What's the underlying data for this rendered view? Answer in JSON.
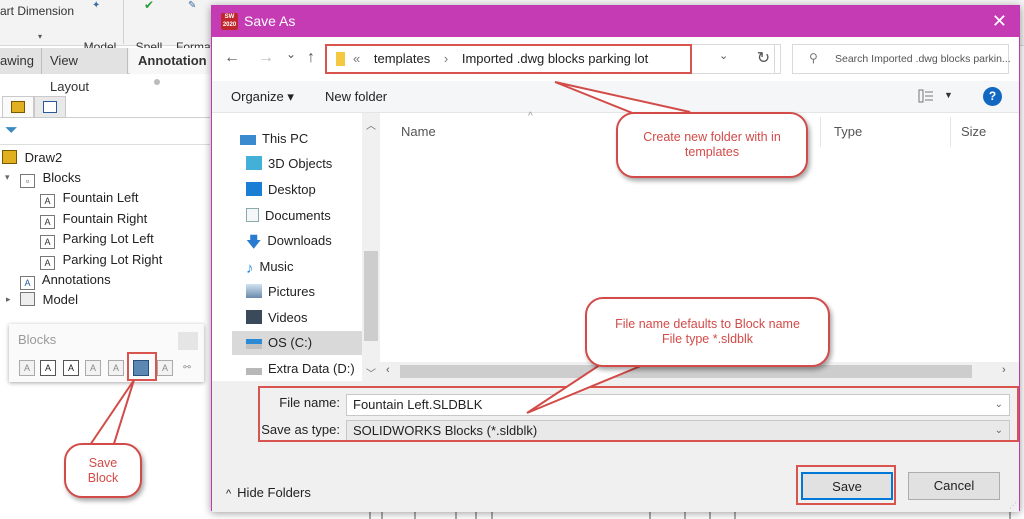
{
  "ribbon": {
    "items": [
      {
        "label": "art Dimension",
        "name": "smart-dimension"
      },
      {
        "label": "Model\nItems",
        "name": "model-items"
      },
      {
        "label": "Spell\nChecker",
        "name": "spell-checker"
      },
      {
        "label": "Forma\nPainte",
        "name": "format-painter"
      }
    ],
    "tabs": [
      "awing",
      "View Layout",
      "Annotation"
    ],
    "active_tab": "Annotation"
  },
  "feature_tree": {
    "root": "Draw2",
    "items": [
      {
        "label": "Blocks",
        "level": 1,
        "expanded": true,
        "icon": "folder-icon"
      },
      {
        "label": "Fountain Left",
        "level": 2,
        "icon": "block-icon"
      },
      {
        "label": "Fountain Right",
        "level": 2,
        "icon": "block-icon"
      },
      {
        "label": "Parking Lot Left",
        "level": 2,
        "icon": "block-icon"
      },
      {
        "label": "Parking Lot Right",
        "level": 2,
        "icon": "block-icon"
      },
      {
        "label": "Annotations",
        "level": 1,
        "icon": "annotations-folder-icon"
      },
      {
        "label": "Model",
        "level": 1,
        "expanded": false,
        "icon": "model-folder-icon"
      }
    ]
  },
  "blocks_toolbar": {
    "title": "Blocks",
    "highlighted_tool": "save-block"
  },
  "callouts": {
    "save_block": "Save\nBlock",
    "new_folder": "Create new folder with in\ntemplates",
    "file_name": "File name defaults to Block name\nFile type *.sldblk"
  },
  "dialog": {
    "title": "Save As",
    "app_icon_text": "SW\n2020",
    "close": "✕",
    "nav": {
      "back": "←",
      "forward": "→",
      "recent": "⌄",
      "up": "↑"
    },
    "address": {
      "prefix": "«",
      "crumbs": [
        "templates",
        "Imported .dwg blocks parking lot"
      ],
      "separator": "›"
    },
    "refresh": "↻",
    "search_placeholder": "Search Imported .dwg blocks parkin...",
    "commands": {
      "organize": "Organize ▾",
      "new_folder": "New folder"
    },
    "help": "?",
    "nav_pane": [
      {
        "label": "This PC",
        "icon": "this-pc-icon",
        "indent": 0
      },
      {
        "label": "3D Objects",
        "icon": "3d-objects-icon",
        "indent": 1
      },
      {
        "label": "Desktop",
        "icon": "desktop-icon",
        "indent": 1
      },
      {
        "label": "Documents",
        "icon": "documents-icon",
        "indent": 1
      },
      {
        "label": "Downloads",
        "icon": "downloads-icon",
        "indent": 1
      },
      {
        "label": "Music",
        "icon": "music-icon",
        "indent": 1
      },
      {
        "label": "Pictures",
        "icon": "pictures-icon",
        "indent": 1
      },
      {
        "label": "Videos",
        "icon": "videos-icon",
        "indent": 1
      },
      {
        "label": "OS (C:)",
        "icon": "drive-c-icon",
        "indent": 1,
        "selected": true
      },
      {
        "label": "Extra Data (D:)",
        "icon": "drive-d-icon",
        "indent": 1
      }
    ],
    "columns": [
      "Name",
      "Type",
      "Size"
    ],
    "file_name_label": "File name:",
    "file_name_value": "Fountain Left.SLDBLK",
    "save_type_label": "Save as type:",
    "save_type_value": "SOLIDWORKS Blocks (*.sldblk)",
    "hide_folders": "Hide Folders",
    "save_button": "Save",
    "cancel_button": "Cancel"
  },
  "colors": {
    "titlebar": "#c43bb4",
    "annotation_red": "#d24b48",
    "help_blue": "#1068c2",
    "primary_button_border": "#0078d7"
  }
}
